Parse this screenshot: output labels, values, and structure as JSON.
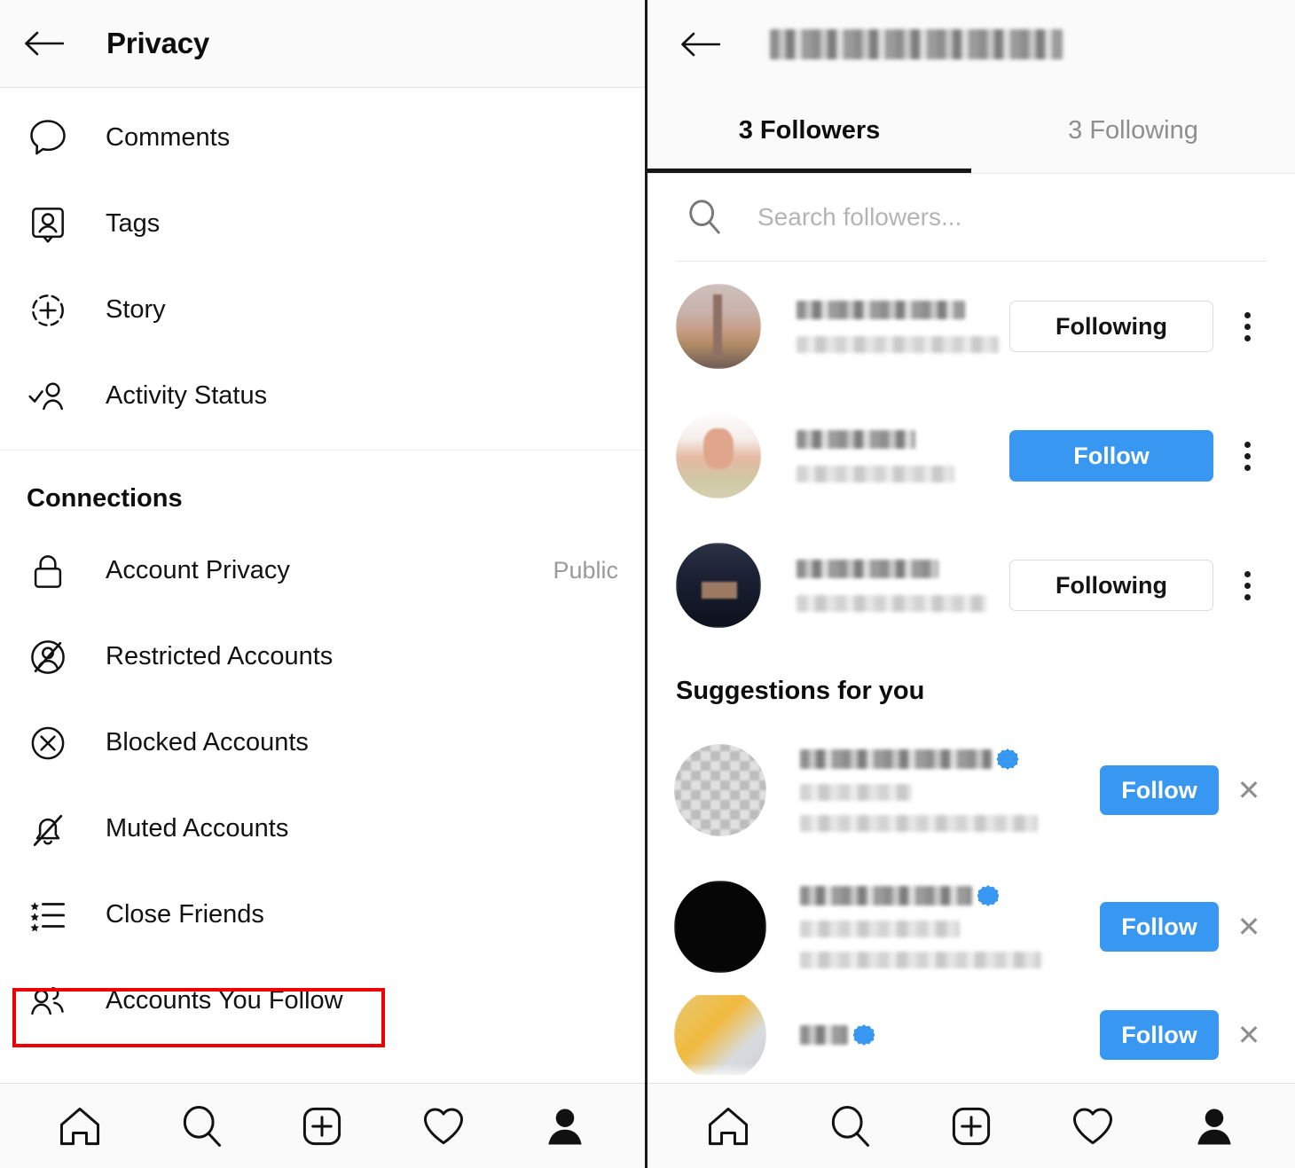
{
  "left_panel": {
    "header": {
      "back_icon": "back-arrow-icon",
      "title": "Privacy"
    },
    "items": [
      {
        "icon": "comment-bubble-icon",
        "label": "Comments",
        "value": ""
      },
      {
        "icon": "tag-person-icon",
        "label": "Tags",
        "value": ""
      },
      {
        "icon": "story-plus-icon",
        "label": "Story",
        "value": ""
      },
      {
        "icon": "activity-status-icon",
        "label": "Activity Status",
        "value": ""
      }
    ],
    "section_title": "Connections",
    "connection_items": [
      {
        "icon": "lock-icon",
        "label": "Account Privacy",
        "value": "Public"
      },
      {
        "icon": "restricted-account-icon",
        "label": "Restricted Accounts",
        "value": ""
      },
      {
        "icon": "blocked-circle-x-icon",
        "label": "Blocked Accounts",
        "value": ""
      },
      {
        "icon": "muted-bell-icon",
        "label": "Muted Accounts",
        "value": ""
      },
      {
        "icon": "close-friends-star-list-icon",
        "label": "Close Friends",
        "value": ""
      },
      {
        "icon": "accounts-you-follow-icon",
        "label": "Accounts You Follow",
        "value": ""
      }
    ]
  },
  "right_panel": {
    "header": {
      "back_icon": "back-arrow-icon",
      "title_blurred": ""
    },
    "tabs": [
      {
        "label": "3 Followers",
        "active": true
      },
      {
        "label": "3 Following",
        "active": false
      }
    ],
    "search": {
      "icon": "search-icon",
      "placeholder": "Search followers...",
      "value": ""
    },
    "followers": [
      {
        "avatar": "avatar-desert",
        "name_blurred": "",
        "subtitle_blurred": "",
        "action": "Following",
        "action_type": "following",
        "menu_icon": "more-vertical-icon"
      },
      {
        "avatar": "avatar-light-portrait",
        "name_blurred": "",
        "subtitle_blurred": "",
        "action": "Follow",
        "action_type": "follow",
        "menu_icon": "more-vertical-icon"
      },
      {
        "avatar": "avatar-suit",
        "name_blurred": "",
        "subtitle_blurred": "",
        "action": "Following",
        "action_type": "following",
        "menu_icon": "more-vertical-icon"
      }
    ],
    "suggestions_title": "Suggestions for you",
    "suggestions": [
      {
        "avatar": "avatar-gray-pixel",
        "verified": true,
        "action": "Follow",
        "dismiss_icon": "close-x-icon"
      },
      {
        "avatar": "avatar-black",
        "verified": true,
        "action": "Follow",
        "dismiss_icon": "close-x-icon"
      },
      {
        "avatar": "avatar-yellow",
        "verified": true,
        "action": "Follow",
        "dismiss_icon": "close-x-icon"
      }
    ]
  },
  "bottom_nav": {
    "items": [
      {
        "icon": "home-icon",
        "label": "Home"
      },
      {
        "icon": "search-icon",
        "label": "Search"
      },
      {
        "icon": "add-post-icon",
        "label": "Create"
      },
      {
        "icon": "heart-icon",
        "label": "Activity"
      },
      {
        "icon": "profile-icon",
        "label": "Profile"
      }
    ]
  },
  "highlights": {
    "accounts_you_follow_box": "accounts-you-follow-highlight",
    "followers_tab_box": "followers-tab-highlight",
    "color": "#ee0000"
  },
  "colors": {
    "follow_blue": "#3897f0",
    "highlight_red": "#ee0000",
    "text_primary": "#0d0d0d",
    "text_muted": "#8e8e8e",
    "header_bg": "#fafafa"
  }
}
